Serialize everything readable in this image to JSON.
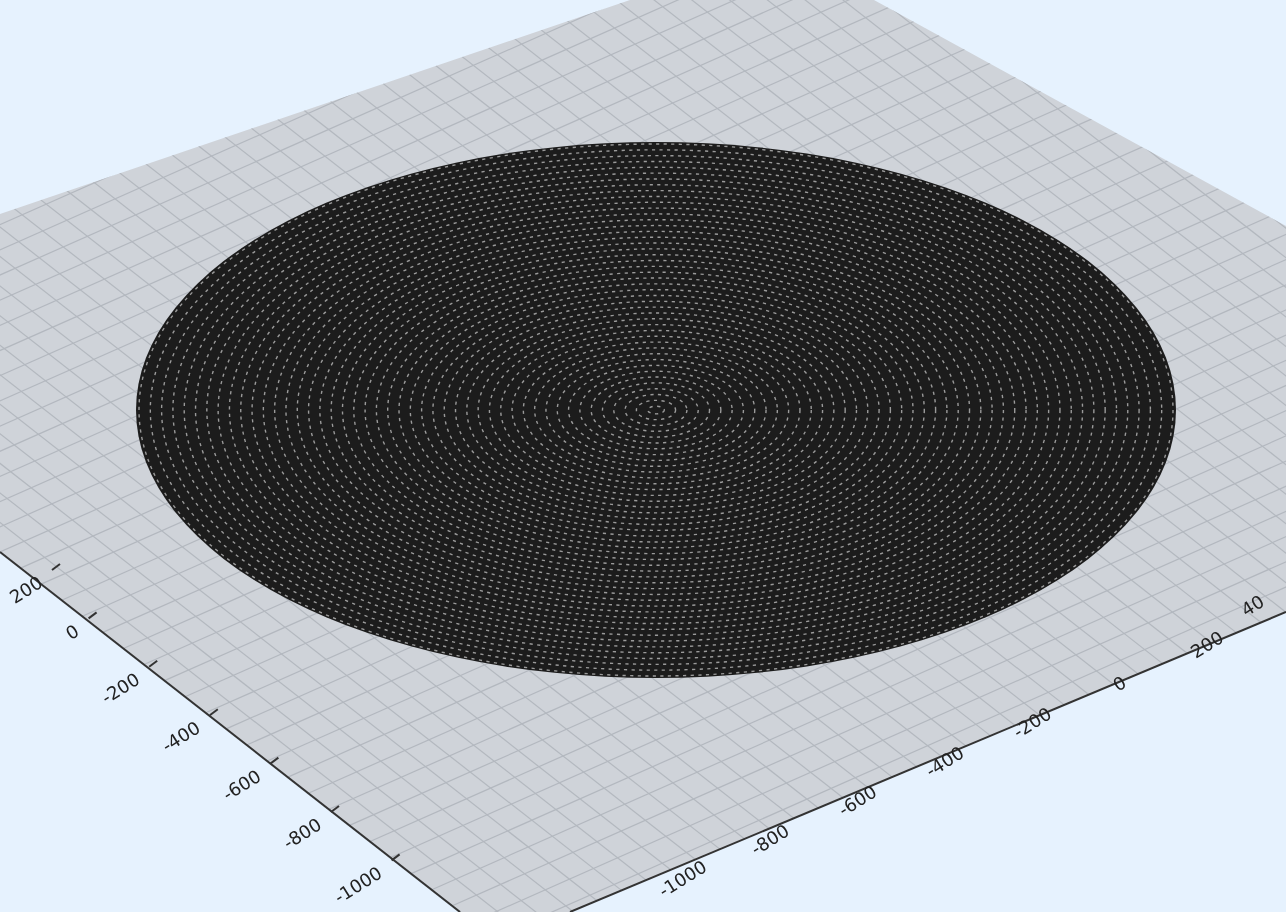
{
  "plot": {
    "left_axis_ticks": [
      "200",
      "0",
      "-200",
      "-400",
      "-600",
      "-800",
      "-1000"
    ],
    "bottom_axis_ticks": [
      "-1000",
      "-800",
      "-600",
      "-400",
      "-200",
      "0",
      "200",
      "40"
    ]
  }
}
